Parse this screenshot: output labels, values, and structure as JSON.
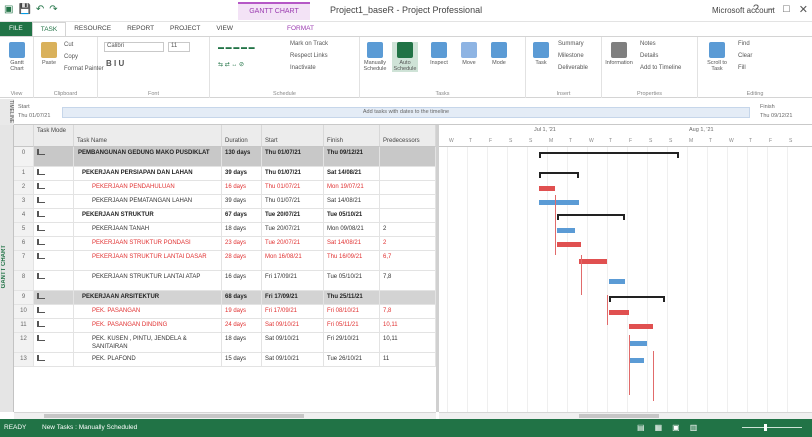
{
  "window": {
    "title": "Project1_baseR - Project Professional",
    "context_tab": "GANTT CHART TOOLS",
    "user": "Microsoft account",
    "controls": [
      "?",
      "–",
      "□",
      "✕"
    ]
  },
  "ribbon_tabs": [
    "FILE",
    "TASK",
    "RESOURCE",
    "REPORT",
    "PROJECT",
    "VIEW",
    "FORMAT"
  ],
  "active_tab": "TASK",
  "ribbon": {
    "groups": [
      {
        "label": "View",
        "buttons": [
          "Gantt Chart"
        ]
      },
      {
        "label": "Clipboard",
        "buttons": [
          "Paste",
          "Cut",
          "Copy",
          "Format Painter"
        ]
      },
      {
        "label": "Font",
        "font_name": "Calibri",
        "font_size": "11"
      },
      {
        "label": "Schedule",
        "buttons": [
          "Mark on Track",
          "Respect Links",
          "Inactivate"
        ]
      },
      {
        "label": "Tasks",
        "buttons": [
          "Manually Schedule",
          "Auto Schedule",
          "Inspect",
          "Move",
          "Mode"
        ]
      },
      {
        "label": "Insert",
        "buttons": [
          "Task",
          "Summary",
          "Milestone",
          "Deliverable"
        ]
      },
      {
        "label": "Properties",
        "buttons": [
          "Information",
          "Notes",
          "Details",
          "Add to Timeline"
        ]
      },
      {
        "label": "Editing",
        "buttons": [
          "Scroll to Task",
          "Find",
          "Clear",
          "Fill"
        ]
      }
    ]
  },
  "timeline": {
    "side_label": "TIMELINE",
    "start_label": "Start",
    "start_value": "Thu 01/07/21",
    "band_text": "Add tasks with dates to the timeline",
    "finish_label": "Finish",
    "finish_value": "Thu 09/12/21"
  },
  "view_bar": {
    "label": "GANTT CHART"
  },
  "columns": [
    "Task Mode",
    "Task Name",
    "Duration",
    "Start",
    "Finish",
    "Predecessors"
  ],
  "tasks": [
    {
      "id": "0",
      "name": "PEMBANGUNAN GEDUNG MAKO PUSDIKLAT",
      "duration": "130 days",
      "start": "Thu 01/07/21",
      "finish": "Thu 09/12/21",
      "pred": "",
      "style": "summary0"
    },
    {
      "id": "1",
      "name": "PEKERJAAN PERSIAPAN DAN LAHAN",
      "duration": "39 days",
      "start": "Thu 01/07/21",
      "finish": "Sat 14/08/21",
      "pred": "",
      "style": "summary"
    },
    {
      "id": "2",
      "name": "PEKERJAAN PENDAHULUAN",
      "duration": "16 days",
      "start": "Thu 01/07/21",
      "finish": "Mon 19/07/21",
      "pred": "",
      "style": "critical"
    },
    {
      "id": "3",
      "name": "PEKERJAAN PEMATANGAN LAHAN",
      "duration": "39 days",
      "start": "Thu 01/07/21",
      "finish": "Sat 14/08/21",
      "pred": "",
      "style": "normal"
    },
    {
      "id": "4",
      "name": "PEKERJAAN STRUKTUR",
      "duration": "67 days",
      "start": "Tue 20/07/21",
      "finish": "Tue 05/10/21",
      "pred": "",
      "style": "summary"
    },
    {
      "id": "5",
      "name": "PEKERJAAN TANAH",
      "duration": "18 days",
      "start": "Tue 20/07/21",
      "finish": "Mon 09/08/21",
      "pred": "2",
      "style": "normal"
    },
    {
      "id": "6",
      "name": "PEKERJAAN STRUKTUR PONDASI",
      "duration": "23 days",
      "start": "Tue 20/07/21",
      "finish": "Sat 14/08/21",
      "pred": "2",
      "style": "critical"
    },
    {
      "id": "7",
      "name": "PEKERJAAN STRUKTUR LANTAI DASAR",
      "duration": "28 days",
      "start": "Mon 16/08/21",
      "finish": "Thu 16/09/21",
      "pred": "6,7",
      "style": "critical"
    },
    {
      "id": "8",
      "name": "PEKERJAAN STRUKTUR LANTAI ATAP",
      "duration": "16 days",
      "start": "Fri 17/09/21",
      "finish": "Tue 05/10/21",
      "pred": "7,8",
      "style": "normal"
    },
    {
      "id": "9",
      "name": "PEKERJAAN ARSITEKTUR",
      "duration": "68 days",
      "start": "Fri 17/09/21",
      "finish": "Thu 25/11/21",
      "pred": "",
      "style": "summary_selected"
    },
    {
      "id": "10",
      "name": "PEK. PASANGAN",
      "duration": "19 days",
      "start": "Fri 17/09/21",
      "finish": "Fri 08/10/21",
      "pred": "7,8",
      "style": "critical"
    },
    {
      "id": "11",
      "name": "PEK. PASANGAN DINDING",
      "duration": "24 days",
      "start": "Sat 09/10/21",
      "finish": "Fri 05/11/21",
      "pred": "10,11",
      "style": "critical"
    },
    {
      "id": "12",
      "name": "PEK. KUSEN , PINTU, JENDELA & SANITAIRAN",
      "duration": "18 days",
      "start": "Sat 09/10/21",
      "finish": "Fri 29/10/21",
      "pred": "10,11",
      "style": "normal"
    },
    {
      "id": "13",
      "name": "PEK. PLAFOND",
      "duration": "15 days",
      "start": "Sat 09/10/21",
      "finish": "Tue 26/10/21",
      "pred": "11",
      "style": "normal"
    }
  ],
  "gantt": {
    "weeks": [
      "Jul 1, '21",
      "Aug 1, '21"
    ],
    "days": [
      "W",
      "T",
      "F",
      "S",
      "S",
      "M",
      "T",
      "W",
      "T",
      "F",
      "S",
      "S",
      "M",
      "T",
      "W",
      "T",
      "F",
      "S"
    ]
  },
  "status": {
    "ready": "READY",
    "new_tasks": "New Tasks : Manually Scheduled"
  },
  "colors": {
    "accent": "#217346",
    "critical": "#e05050",
    "task": "#5b9bd5",
    "summary_row": "#c8c8c8"
  }
}
